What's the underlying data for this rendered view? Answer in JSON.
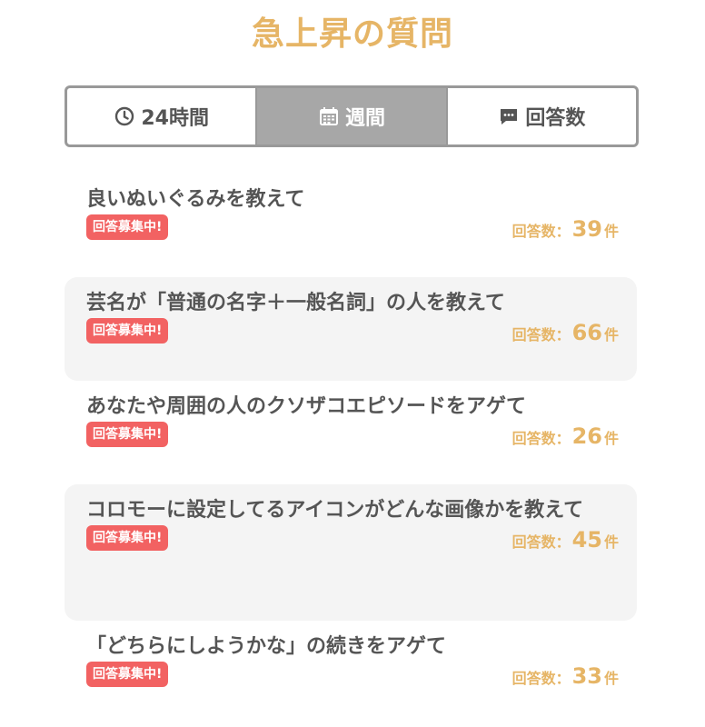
{
  "page": {
    "title": "急上昇の質問"
  },
  "tabs": [
    {
      "label": "24時間",
      "icon": "clock-icon",
      "active": false
    },
    {
      "label": "週間",
      "icon": "calendar-icon",
      "active": true
    },
    {
      "label": "回答数",
      "icon": "comment-icon",
      "active": false
    }
  ],
  "questions": [
    {
      "text": "良いぬいぐるみを教えて",
      "badge": "回答募集中!",
      "count_label": "回答数：",
      "count": "39",
      "count_unit": "件"
    },
    {
      "text": "芸名が「普通の名字＋一般名詞」の人を教えて",
      "badge": "回答募集中!",
      "count_label": "回答数：",
      "count": "66",
      "count_unit": "件"
    },
    {
      "text": "あなたや周囲の人のクソザコエピソードをアゲて",
      "badge": "回答募集中!",
      "count_label": "回答数：",
      "count": "26",
      "count_unit": "件"
    },
    {
      "text": "コロモーに設定してるアイコンがどんな画像かを教えて",
      "badge": "回答募集中!",
      "count_label": "回答数：",
      "count": "45",
      "count_unit": "件"
    },
    {
      "text": "「どちらにしようかな」の続きをアゲて",
      "badge": "回答募集中!",
      "count_label": "回答数：",
      "count": "33",
      "count_unit": "件"
    }
  ],
  "colors": {
    "accent": "#E6B566",
    "badge": "#F26262",
    "active_tab": "#A7A7A7",
    "text": "#555555",
    "shaded_row": "#F4F4F4"
  }
}
